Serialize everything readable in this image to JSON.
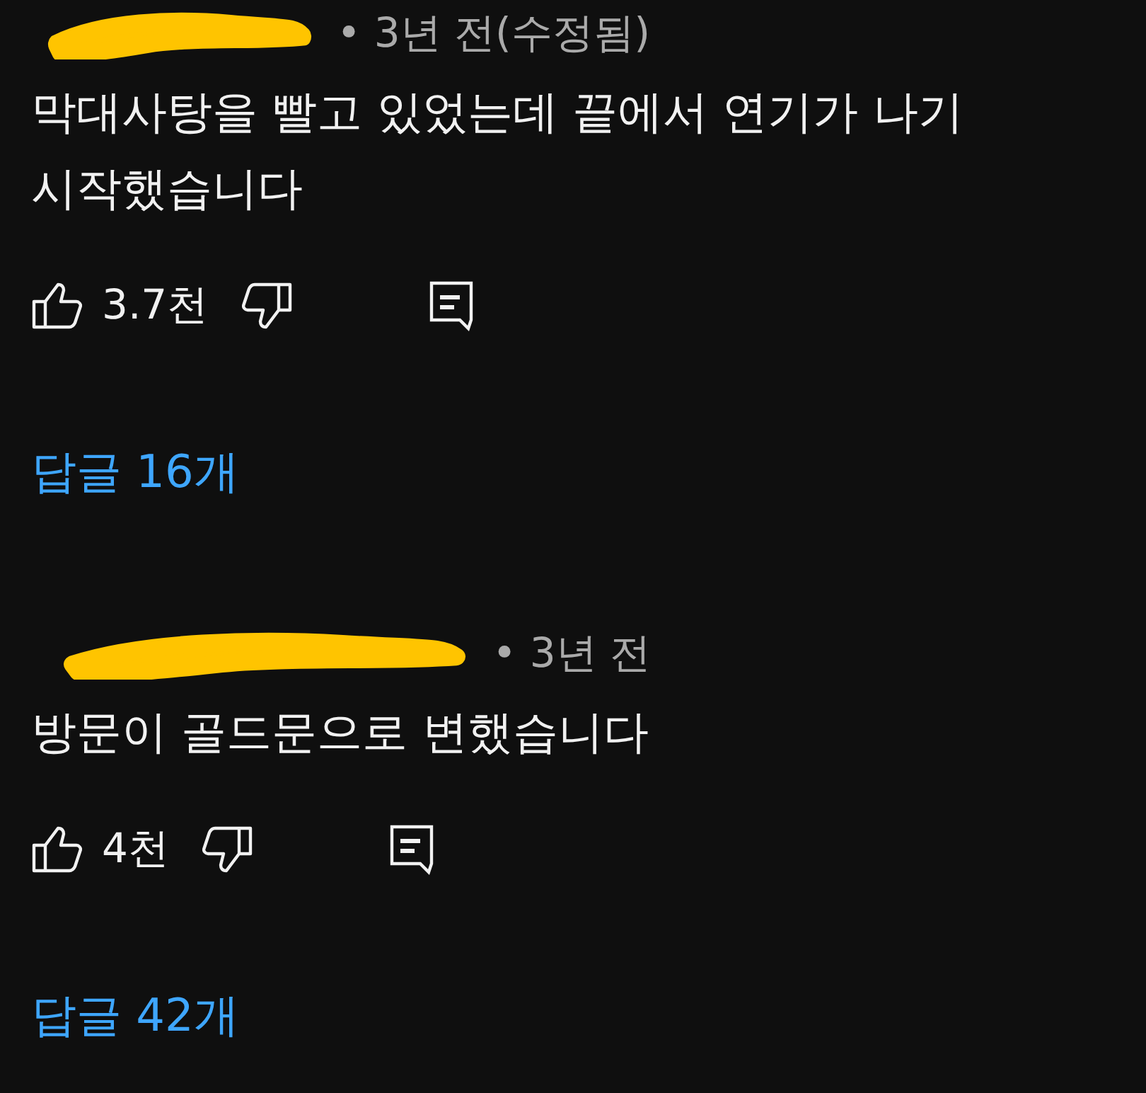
{
  "comments": [
    {
      "author_redacted": true,
      "meta": "• 3년 전(수정됨)",
      "text": [
        "막대사탕을 빨고 있었는데 끝에서 연기가 나기",
        "시작했습니다"
      ],
      "likes": "3.7천",
      "replies": "답글 16개"
    },
    {
      "author_redacted": true,
      "meta": "• 3년 전",
      "text": [
        "방문이 골드문으로 변했습니다"
      ],
      "likes": "4천",
      "replies": "답글 42개"
    }
  ]
}
